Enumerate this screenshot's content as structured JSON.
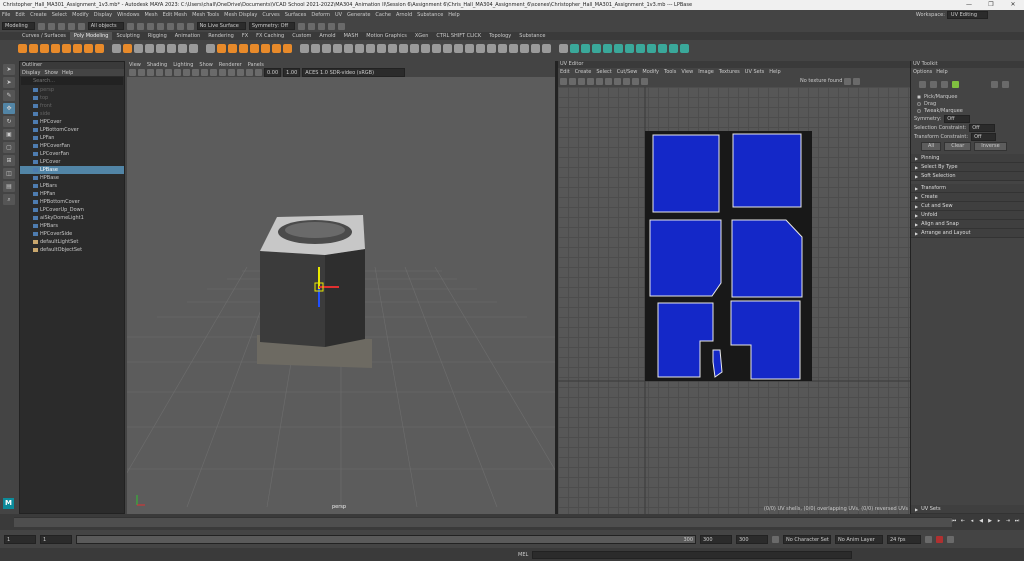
{
  "title": "Christopher_Hall_MA301_Assignment_1v3.mb* - Autodesk MAYA 2023: C:\\Users\\chall\\OneDrive\\Documents\\VCAD School 2021-2022\\MA304_Animation II\\Session 6\\Assignment 6\\Chris_Hall_MA304_Assignment_6\\scenes\\Christopher_Hall_MA301_Assignment_1v3.mb  ---  LPBase",
  "window_controls": [
    "—",
    "❐",
    "✕"
  ],
  "menus": [
    "File",
    "Edit",
    "Create",
    "Select",
    "Modify",
    "Display",
    "Windows",
    "Mesh",
    "Edit Mesh",
    "Mesh Tools",
    "Mesh Display",
    "Curves",
    "Surfaces",
    "Deform",
    "UV",
    "Generate",
    "Cache",
    "Arnold",
    "Substance",
    "Help"
  ],
  "workspace": {
    "label": "Workspace:",
    "value": "UV Editing"
  },
  "status": {
    "mode": "Modeling",
    "objects": "All objects",
    "live": "No Live Surface",
    "symmetry": "Symmetry: Off"
  },
  "shelf_tabs": [
    "Curves / Surfaces",
    "Poly Modeling",
    "Sculpting",
    "Rigging",
    "Animation",
    "Rendering",
    "FX",
    "FX Caching",
    "Custom",
    "Arnold",
    "MASH",
    "Motion Graphics",
    "XGen",
    "CTRL SHIFT CLICK",
    "Topology",
    "Substance"
  ],
  "shelf_active": 1,
  "outliner": {
    "title": "Outliner",
    "menus": [
      "Display",
      "Show",
      "Help"
    ],
    "search": "Search...",
    "items": [
      {
        "label": "persp",
        "dim": true
      },
      {
        "label": "top",
        "dim": true
      },
      {
        "label": "front",
        "dim": true
      },
      {
        "label": "side",
        "dim": true
      },
      {
        "label": "HPCover"
      },
      {
        "label": "LPBottomCover"
      },
      {
        "label": "LPFan"
      },
      {
        "label": "HPCoverFan"
      },
      {
        "label": "LPCoverFan"
      },
      {
        "label": "LPCover"
      },
      {
        "label": "LPBase",
        "selected": true
      },
      {
        "label": "HPBase"
      },
      {
        "label": "LPBars"
      },
      {
        "label": "HPFan"
      },
      {
        "label": "HPBottomCover"
      },
      {
        "label": "LPCoverUp_Down"
      },
      {
        "label": "aiSkyDomeLight1"
      },
      {
        "label": "HPBars"
      },
      {
        "label": "HPCoverSide"
      },
      {
        "label": "defaultLightSet",
        "group": true
      },
      {
        "label": "defaultObjectSet",
        "group": true
      }
    ]
  },
  "viewport": {
    "menus": [
      "View",
      "Shading",
      "Lighting",
      "Show",
      "Renderer",
      "Panels"
    ],
    "field_a": "0.00",
    "field_b": "1.00",
    "colorspace": "ACES 1.0 SDR-video (sRGB)",
    "camera": "persp"
  },
  "uv_editor": {
    "title": "UV Editor",
    "menus": [
      "Edit",
      "Create",
      "Select",
      "Cut/Sew",
      "Modify",
      "Tools",
      "View",
      "Image",
      "Textures",
      "UV Sets",
      "Help"
    ],
    "texture": "No texture found",
    "status": "(0/0) UV shells, (0/0) overlapping UVs, (0/0) reversed UVs"
  },
  "uv_toolkit": {
    "title": "UV Toolkit",
    "menus": [
      "Options",
      "Help"
    ],
    "modes": [
      "Pick/Marquee",
      "Drag",
      "Tweak/Marquee"
    ],
    "mode_selected": 0,
    "symmetry": {
      "label": "Symmetry:",
      "value": "Off"
    },
    "selection_constraint": {
      "label": "Selection Constraint:",
      "value": "Off"
    },
    "transform_constraint": {
      "label": "Transform Constraint:",
      "value": "Off"
    },
    "buttons": [
      "All",
      "Clear",
      "Inverse"
    ],
    "sections": [
      "Pinning",
      "Select By Type",
      "Soft Selection",
      "Transform",
      "Create",
      "Cut and Sew",
      "Unfold",
      "Align and Snap",
      "Arrange and Layout"
    ],
    "uv_sets": "UV Sets"
  },
  "range": {
    "start": "1",
    "cur": "1",
    "end_a": "300",
    "end_b": "300",
    "end_c": "300",
    "character": "No Character Set",
    "anim_layer": "No Anim Layer",
    "fps": "24 fps",
    "slider_mark": "300"
  },
  "cmdline": {
    "label": "MEL"
  },
  "logo": "M"
}
